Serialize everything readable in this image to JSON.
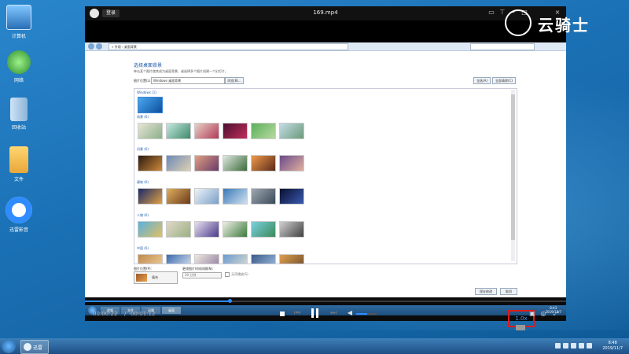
{
  "desktop": {
    "icons": [
      {
        "label": "计算机",
        "icon": "computer-icon"
      },
      {
        "label": "网络",
        "icon": "network-icon"
      },
      {
        "label": "回收站",
        "icon": "recycle-bin-icon"
      },
      {
        "label": "文件",
        "icon": "folder-icon"
      },
      {
        "label": "迅雷影音",
        "icon": "player-app-icon"
      }
    ]
  },
  "player": {
    "login_label": "登录",
    "file_name": "169.mp4",
    "current_time": "00:00:22",
    "time_separator": "/",
    "total_time": "00:01:12",
    "progress": 0.3,
    "volume": 0.55,
    "speed_label": "1.0x",
    "accent_color": "#2f8cff",
    "highlight_color": "#e01b1b"
  },
  "watermark": {
    "text": "云骑士"
  },
  "inner_window": {
    "breadcrumb": "« 外观 › 桌面背景",
    "title": "选择桌面背景",
    "subtitle": "单击某个图片使其成为桌面背景，或选择多个图片创建一个幻灯片。",
    "location_label": "图片位置(L):",
    "location_value": "Windows 桌面背景",
    "browse_label": "浏览(B)...",
    "select_all_label": "全选(A)",
    "clear_all_label": "全部清除(C)",
    "categories": [
      {
        "name": "Windows (1)",
        "count": 1
      },
      {
        "name": "场景 (6)",
        "count": 6
      },
      {
        "name": "风景 (6)",
        "count": 6
      },
      {
        "name": "建筑 (6)",
        "count": 6
      },
      {
        "name": "人物 (6)",
        "count": 6
      },
      {
        "name": "中国 (6)",
        "count": 6
      }
    ],
    "position_label": "图片位置(P):",
    "position_value": "填充",
    "interval_label": "更改图片时间间隔(N):",
    "interval_value": "30 分钟",
    "shuffle_label": "无序播放(S)",
    "save_label": "保存修改",
    "cancel_label": "取消",
    "taskbar_items": [
      "视频",
      "文件",
      "迅雷",
      "桌面"
    ],
    "clock_time": "8:43",
    "clock_date": "2019/11/7"
  },
  "taskbar": {
    "item_label": "迅雷",
    "clock_time": "8:48",
    "clock_date": "2019/11/7"
  }
}
